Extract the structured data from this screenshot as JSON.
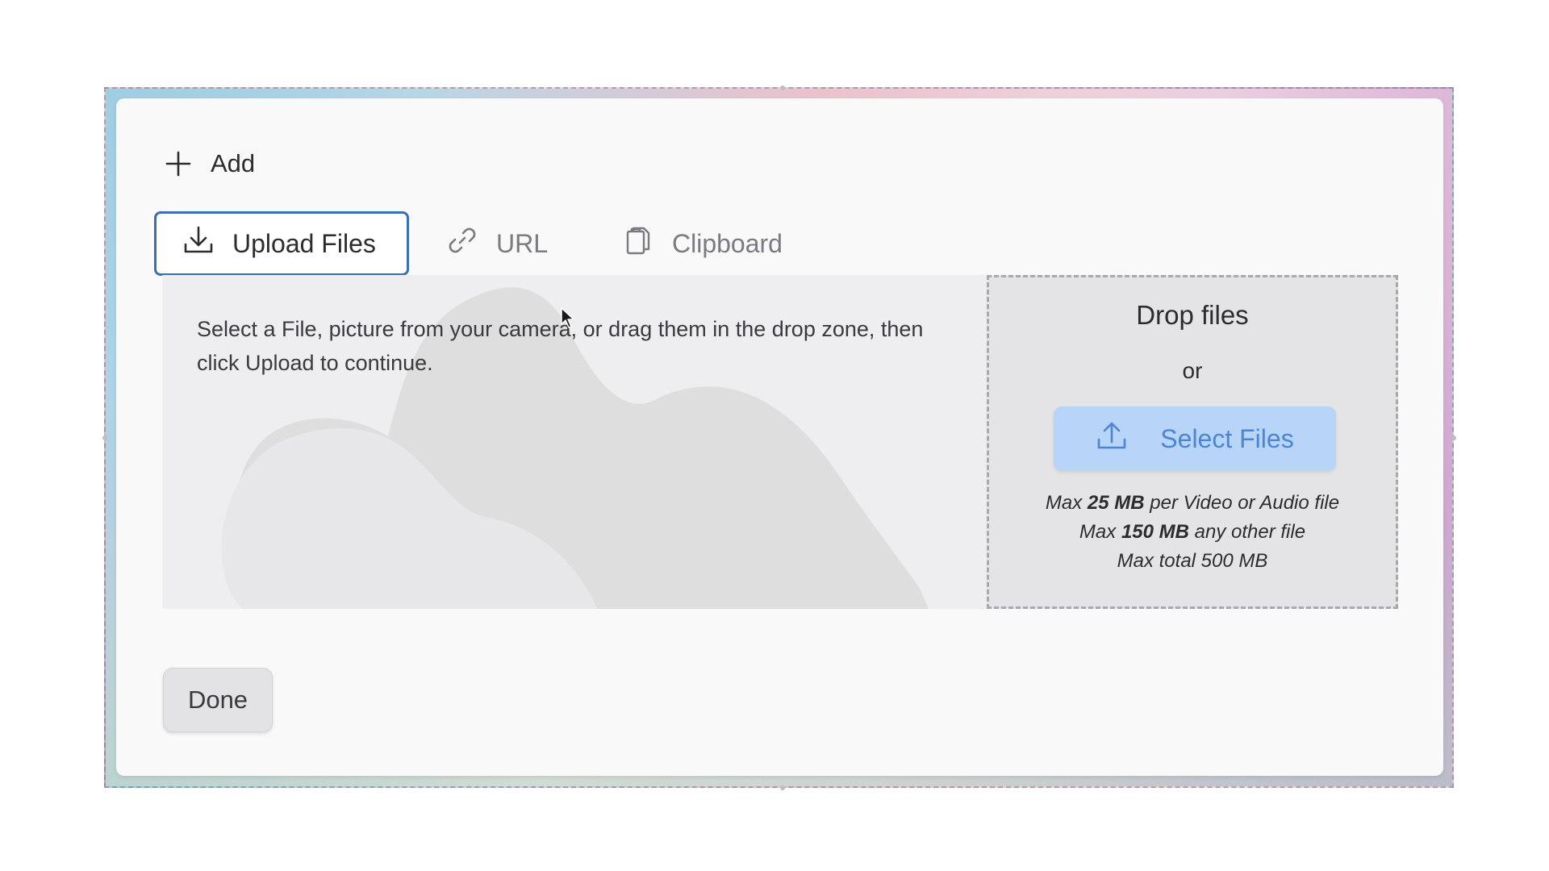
{
  "header": {
    "add_label": "Add"
  },
  "tabs": [
    {
      "label": "Upload Files",
      "icon": "download-icon",
      "active": true
    },
    {
      "label": "URL",
      "icon": "link-icon",
      "active": false
    },
    {
      "label": "Clipboard",
      "icon": "clipboard-icon",
      "active": false
    }
  ],
  "upload": {
    "instructions": "Select a File, picture from your camera, or drag them in the drop zone, then click Upload to continue."
  },
  "dropzone": {
    "title": "Drop files",
    "or": "or",
    "select_label": "Select Files",
    "limit_video_prefix": "Max ",
    "limit_video_value": "25 MB",
    "limit_video_suffix": " per Video or Audio file",
    "limit_other_prefix": "Max ",
    "limit_other_value": "150 MB",
    "limit_other_suffix": " any other file",
    "limit_total": "Max total 500 MB"
  },
  "footer": {
    "done_label": "Done"
  },
  "colors": {
    "accent_border": "#3a6fb0",
    "select_button_bg": "#b8d4f7",
    "select_button_text": "#4a86d4"
  }
}
